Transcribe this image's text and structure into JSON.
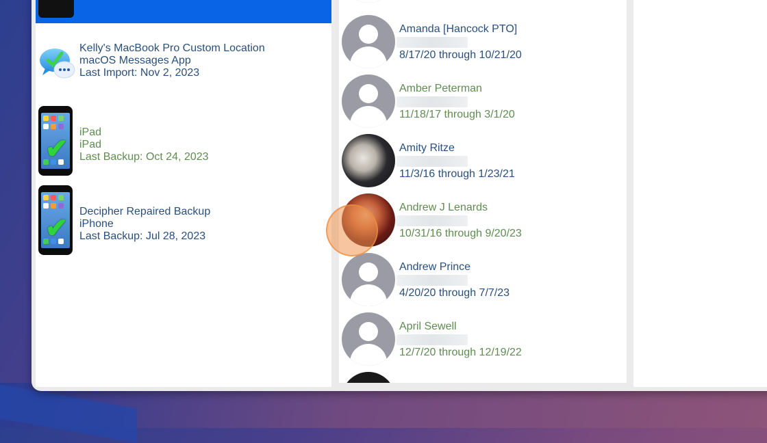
{
  "backups": [
    {
      "name": "Kelly's MacBook Pro Custom Location",
      "type": "macOS Messages App",
      "date": "Last Import: Nov 2, 2023",
      "icon": "messages-icon",
      "color": "blue"
    },
    {
      "name": "iPad",
      "type": "iPad",
      "date": "Last Backup: Oct 24, 2023",
      "icon": "iphone-check-icon",
      "color": "green"
    },
    {
      "name": "Decipher Repaired Backup",
      "type": "iPhone",
      "date": "Last Backup: Jul 28, 2023",
      "icon": "iphone-check-icon",
      "color": "blue"
    }
  ],
  "contacts": [
    {
      "name": "Amanda [Hancock PTO]",
      "dates": "8/17/20 through 10/21/20",
      "avatar": "default",
      "color": "blue"
    },
    {
      "name": "Amber Peterman",
      "dates": "11/18/17 through 3/1/20",
      "avatar": "default",
      "color": "green"
    },
    {
      "name": "Amity Ritze",
      "dates": "11/3/16 through 1/23/21",
      "avatar": "photo",
      "color": "blue"
    },
    {
      "name": "Andrew J Lenards",
      "dates": "10/31/16 through 9/20/23",
      "avatar": "photo",
      "color": "green"
    },
    {
      "name": "Andrew Prince",
      "dates": "4/20/20 through 7/7/23",
      "avatar": "default",
      "color": "blue"
    },
    {
      "name": "April Sewell",
      "dates": "12/7/20 through 12/19/22",
      "avatar": "default",
      "color": "green"
    }
  ],
  "colors": {
    "selection": "#0a64e6",
    "blue_text": "#2a4f7a",
    "green_text": "#5f8c50",
    "cursor_highlight": "#f0964f"
  }
}
